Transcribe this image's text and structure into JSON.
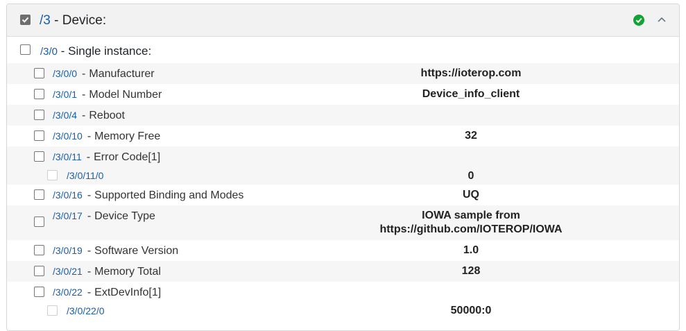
{
  "header": {
    "path": "/3",
    "sep": "-",
    "title": "Device:"
  },
  "instance": {
    "path": "/3/0",
    "sep": "-",
    "title": "Single instance:"
  },
  "resources": [
    {
      "path": "/3/0/0",
      "name": "Manufacturer",
      "value": "https://ioterop.com"
    },
    {
      "path": "/3/0/1",
      "name": "Model Number",
      "value": "Device_info_client"
    },
    {
      "path": "/3/0/4",
      "name": "Reboot",
      "value": ""
    },
    {
      "path": "/3/0/10",
      "name": "Memory Free",
      "value": "32"
    },
    {
      "path": "/3/0/11",
      "name": "Error Code[1]",
      "value": ""
    },
    {
      "path": "/3/0/11/0",
      "name": "",
      "value": "0"
    },
    {
      "path": "/3/0/16",
      "name": "Supported Binding and Modes",
      "value": "UQ"
    },
    {
      "path": "/3/0/17",
      "name": "Device Type",
      "value": "IOWA sample from",
      "value2": "https://github.com/IOTEROP/IOWA"
    },
    {
      "path": "/3/0/19",
      "name": "Software Version",
      "value": "1.0"
    },
    {
      "path": "/3/0/21",
      "name": "Memory Total",
      "value": "128"
    },
    {
      "path": "/3/0/22",
      "name": "ExtDevInfo[1]",
      "value": ""
    },
    {
      "path": "/3/0/22/0",
      "name": "",
      "value": "50000:0"
    }
  ]
}
